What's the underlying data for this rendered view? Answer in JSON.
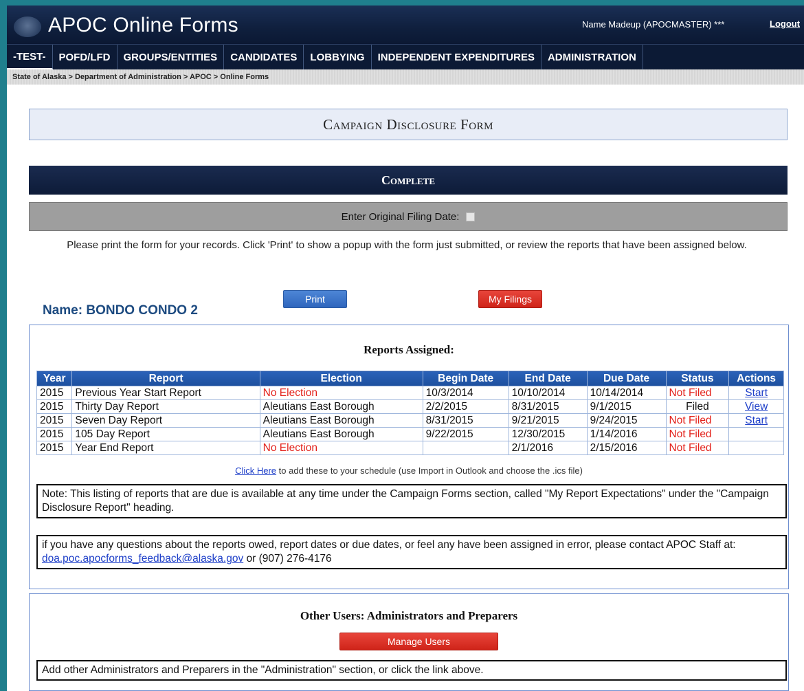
{
  "header": {
    "app_title": "APOC Online Forms",
    "user_name": "Name Madeup (APOCMASTER) ***",
    "logout_label": "Logout"
  },
  "nav": {
    "items": [
      {
        "label": "-TEST-"
      },
      {
        "label": "POFD/LFD"
      },
      {
        "label": "GROUPS/ENTITIES"
      },
      {
        "label": "CANDIDATES"
      },
      {
        "label": "LOBBYING"
      },
      {
        "label": "INDEPENDENT EXPENDITURES"
      },
      {
        "label": "ADMINISTRATION"
      }
    ]
  },
  "breadcrumb": "State of Alaska > Department of Administration > APOC > Online Forms",
  "form": {
    "title": "Campaign Disclosure Form",
    "status_title": "Complete",
    "filing_date_label": "Enter Original Filing Date:",
    "instructions": "Please print the form for your records. Click 'Print' to show a popup with the form just submitted, or review the reports that have been assigned below.",
    "print_label": "Print",
    "my_filings_label": "My Filings",
    "name_line": "Name: BONDO CONDO 2"
  },
  "reports": {
    "title": "Reports Assigned:",
    "columns": [
      "Year",
      "Report",
      "Election",
      "Begin Date",
      "End Date",
      "Due Date",
      "Status",
      "Actions"
    ],
    "rows": [
      {
        "year": "2015",
        "report": "Previous Year Start Report",
        "election": "No Election",
        "begin": "10/3/2014",
        "end": "10/10/2014",
        "due": "10/14/2014",
        "status": "Not Filed",
        "action": "Start"
      },
      {
        "year": "2015",
        "report": "Thirty Day Report",
        "election": "Aleutians East Borough",
        "begin": "2/2/2015",
        "end": "8/31/2015",
        "due": "9/1/2015",
        "status": "Filed",
        "action": "View"
      },
      {
        "year": "2015",
        "report": "Seven Day Report",
        "election": "Aleutians East Borough",
        "begin": "8/31/2015",
        "end": "9/21/2015",
        "due": "9/24/2015",
        "status": "Not Filed",
        "action": "Start"
      },
      {
        "year": "2015",
        "report": "105 Day Report",
        "election": "Aleutians East Borough",
        "begin": "9/22/2015",
        "end": "12/30/2015",
        "due": "1/14/2016",
        "status": "Not Filed",
        "action": ""
      },
      {
        "year": "2015",
        "report": "Year End Report",
        "election": "No Election",
        "begin": "",
        "end": "2/1/2016",
        "due": "2/15/2016",
        "status": "Not Filed",
        "action": ""
      }
    ],
    "schedule_link": "Click Here",
    "schedule_text": " to add these to your schedule (use Import in Outlook and choose the .ics file)",
    "note": "Note: This listing of reports that are due is available at any time under the Campaign Forms section, called \"My Report Expectations\" under the \"Campaign Disclosure Report\" heading.",
    "contact_prefix": "if you have any questions about the reports owed, report dates or due dates, or feel any have been assigned in error, please contact APOC Staff at: ",
    "contact_email": "doa.poc.apocforms_feedback@alaska.gov",
    "contact_suffix": " or (907) 276-4176"
  },
  "other_users": {
    "title": "Other Users: Administrators and Preparers",
    "manage_label": "Manage Users",
    "note": "Add other Administrators and Preparers in the \"Administration\" section, or click the link above."
  }
}
